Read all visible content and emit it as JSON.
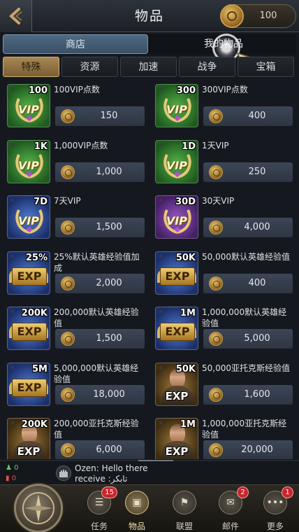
{
  "header": {
    "title": "物品",
    "gold_amount": "100"
  },
  "main_tabs": [
    {
      "label": "商店",
      "active": true
    },
    {
      "label": "我的物品",
      "active": false
    }
  ],
  "sub_tabs": [
    {
      "label": "特殊",
      "active": true
    },
    {
      "label": "资源",
      "active": false
    },
    {
      "label": "加速",
      "active": false
    },
    {
      "label": "战争",
      "active": false
    },
    {
      "label": "宝箱",
      "active": false
    }
  ],
  "items": [
    {
      "qty": "100",
      "name": "100VIP点数",
      "price": "150",
      "kind": "vip",
      "color": "green"
    },
    {
      "qty": "300",
      "name": "300VIP点数",
      "price": "400",
      "kind": "vip",
      "color": "green"
    },
    {
      "qty": "1K",
      "name": "1,000VIP点数",
      "price": "1,000",
      "kind": "vip",
      "color": "green"
    },
    {
      "qty": "1D",
      "name": "1天VIP",
      "price": "250",
      "kind": "vip",
      "color": "green"
    },
    {
      "qty": "7D",
      "name": "7天VIP",
      "price": "1,500",
      "kind": "vip",
      "color": "blue"
    },
    {
      "qty": "30D",
      "name": "30天VIP",
      "price": "4,000",
      "kind": "vip",
      "color": "purple"
    },
    {
      "qty": "25%",
      "name": "25%默认英雄经验值加成",
      "price": "2,000",
      "kind": "exp",
      "color": "blue"
    },
    {
      "qty": "50K",
      "name": "50,000默认英雄经验值",
      "price": "400",
      "kind": "exp",
      "color": "blue"
    },
    {
      "qty": "200K",
      "name": "200,000默认英雄经验值",
      "price": "1,500",
      "kind": "exp",
      "color": "blue"
    },
    {
      "qty": "1M",
      "name": "1,000,000默认英雄经验值",
      "price": "5,000",
      "kind": "exp",
      "color": "blue"
    },
    {
      "qty": "5M",
      "name": "5,000,000默认英雄经验值",
      "price": "18,000",
      "kind": "exp",
      "color": "blue"
    },
    {
      "qty": "50K",
      "name": "50,000亚托克斯经验值",
      "price": "1,600",
      "kind": "hero",
      "color": "gold"
    },
    {
      "qty": "200K",
      "name": "200,000亚托克斯经验值",
      "price": "6,000",
      "kind": "hero",
      "color": "gold"
    },
    {
      "qty": "1M",
      "name": "1,000,000亚托克斯经验值",
      "price": "20,000",
      "kind": "hero",
      "color": "gold"
    }
  ],
  "icon_labels": {
    "vip": "VIP",
    "exp": "EXP"
  },
  "chat": {
    "stat_top": "0",
    "stat_bottom": "0",
    "message_line1": "Ozen: Hello there",
    "message_line2": "receive :تابکر"
  },
  "bottom_nav": [
    {
      "label": "任务",
      "badge": "15",
      "icon": "scroll-icon",
      "active": false
    },
    {
      "label": "物品",
      "badge": "",
      "icon": "bag-icon",
      "active": true
    },
    {
      "label": "联盟",
      "badge": "",
      "icon": "alliance-icon",
      "active": false
    },
    {
      "label": "邮件",
      "badge": "2",
      "icon": "mail-icon",
      "active": false
    },
    {
      "label": "更多",
      "badge": "1",
      "icon": "more-icon",
      "active": false
    }
  ]
}
